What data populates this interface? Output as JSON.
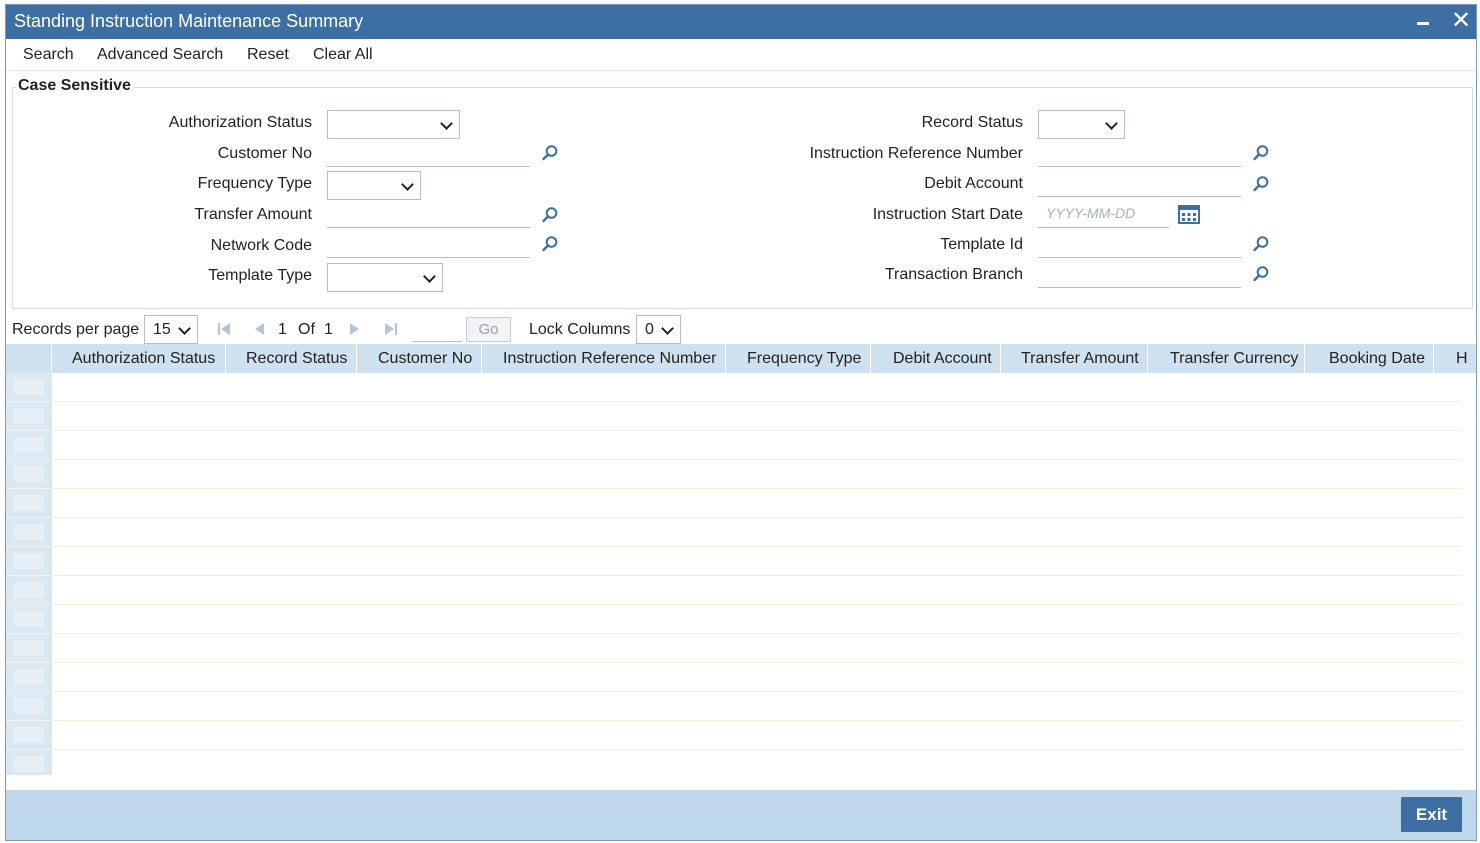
{
  "window": {
    "title": "Standing Instruction Maintenance Summary",
    "minimize_icon": "minimize-icon",
    "close_icon": "close-icon",
    "close_glyph": "✕"
  },
  "toolbar": {
    "search": "Search",
    "advanced_search": "Advanced Search",
    "reset": "Reset",
    "clear_all": "Clear All"
  },
  "criteria": {
    "legend": "Case Sensitive",
    "left": {
      "authorization_status": {
        "label": "Authorization Status",
        "value": ""
      },
      "customer_no": {
        "label": "Customer No",
        "value": ""
      },
      "frequency_type": {
        "label": "Frequency Type",
        "value": ""
      },
      "transfer_amount": {
        "label": "Transfer Amount",
        "value": ""
      },
      "network_code": {
        "label": "Network Code",
        "value": ""
      },
      "template_type": {
        "label": "Template Type",
        "value": ""
      }
    },
    "right": {
      "record_status": {
        "label": "Record Status",
        "value": ""
      },
      "instruction_reference_number": {
        "label": "Instruction Reference Number",
        "value": ""
      },
      "debit_account": {
        "label": "Debit Account",
        "value": ""
      },
      "instruction_start_date": {
        "label": "Instruction Start Date",
        "value": "",
        "placeholder": "YYYY-MM-DD"
      },
      "template_id": {
        "label": "Template Id",
        "value": ""
      },
      "transaction_branch": {
        "label": "Transaction Branch",
        "value": ""
      }
    }
  },
  "pager": {
    "records_per_page_label": "Records per page",
    "records_per_page_value": "15",
    "current_page": "1",
    "of_label": "Of",
    "total_pages": "1",
    "go_label": "Go",
    "lock_columns_label": "Lock Columns",
    "lock_columns_value": "0"
  },
  "grid": {
    "columns": [
      "Authorization Status",
      "Record Status",
      "Customer No",
      "Instruction Reference Number",
      "Frequency Type",
      "Debit Account",
      "Transfer Amount",
      "Transfer Currency",
      "Booking Date",
      "H"
    ],
    "rows": []
  },
  "footer": {
    "exit": "Exit"
  },
  "colors": {
    "titlebar": "#3d6fa5",
    "grid_header": "#cfe0ee",
    "footer": "#bfd7eb",
    "exit_button": "#3d6fa5",
    "lookup_icon": "#3d6fa5"
  }
}
